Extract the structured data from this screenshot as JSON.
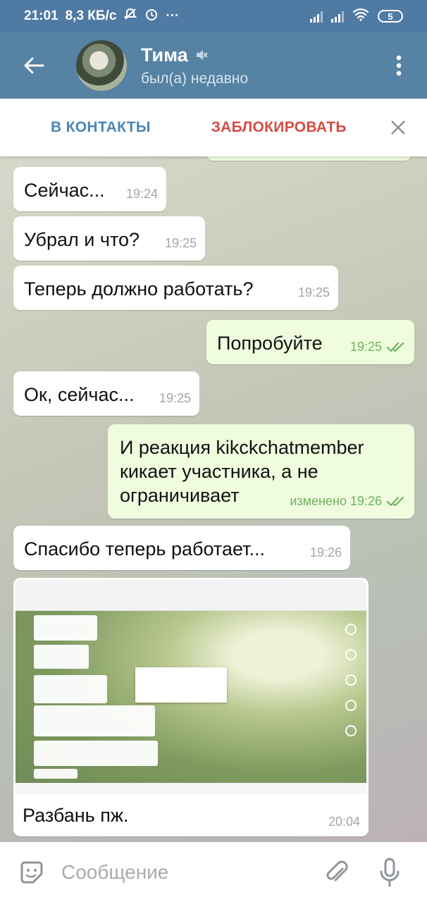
{
  "status_bar": {
    "time": "21:01",
    "speed": "8,3 КБ/с",
    "extra": "···",
    "battery": "5"
  },
  "header": {
    "name": "Тима",
    "status": "был(а) недавно"
  },
  "action_bar": {
    "add_contact": "В КОНТАКТЫ",
    "block": "ЗАБЛОКИРОВАТЬ"
  },
  "messages": [
    {
      "text": "Сейчас...",
      "time": "19:24",
      "dir": "in"
    },
    {
      "text": "Убрал и что?",
      "time": "19:25",
      "dir": "in"
    },
    {
      "text": "Теперь должно работать?",
      "time": "19:25",
      "dir": "in"
    },
    {
      "text": "Попробуйте",
      "time": "19:25",
      "dir": "out"
    },
    {
      "text": "Ок, сейчас...",
      "time": "19:25",
      "dir": "in"
    },
    {
      "text": "И реакция kikckchatmember\nкикает участника, а не\nограничивает",
      "time": "изменено 19:26",
      "dir": "out"
    },
    {
      "text": "Спасибо теперь работает...",
      "time": "19:26",
      "dir": "in"
    },
    {
      "text": "Разбань пж.",
      "time": "20:04",
      "dir": "in"
    }
  ],
  "composer": {
    "placeholder": "Сообщение"
  },
  "colors": {
    "header": "#5682a3",
    "status_bar": "#4f7aa3",
    "accent": "#4a86b5",
    "danger": "#d44c44",
    "outgoing": "#effdde",
    "check": "#6fb15f"
  }
}
